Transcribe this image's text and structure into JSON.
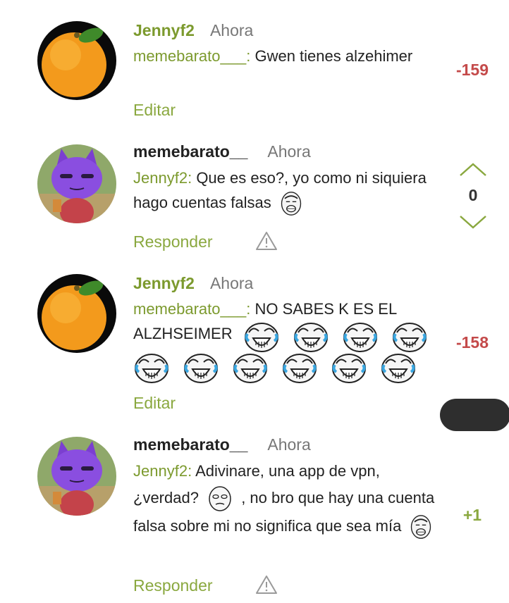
{
  "comments": [
    {
      "author": "Jennyf2",
      "time": "Ahora",
      "mention": "memebarato___",
      "text": "Gwen tienes alzehimer",
      "action": "Editar",
      "score": "-159",
      "avatar": "orange-avatar"
    },
    {
      "author": "memebarato__",
      "time": "Ahora",
      "mention": "Jennyf2",
      "text": "Que es eso?, yo como ni siquiera hago cuentas falsas",
      "action": "Responder",
      "score": "0",
      "avatar": "purple-cat-avatar"
    },
    {
      "author": "Jennyf2",
      "time": "Ahora",
      "mention": "memebarato___",
      "text": "NO SABES K ES EL ALZHSEIMER",
      "action": "Editar",
      "score": "-158",
      "avatar": "orange-avatar"
    },
    {
      "author": "memebarato__",
      "time": "Ahora",
      "mention": "Jennyf2",
      "text_part1": "Adivinare, una app de vpn, ¿verdad?",
      "text_part2": ", no bro que hay una cuenta falsa sobre mi no significa que sea mía",
      "action": "Responder",
      "score": "+1",
      "avatar": "purple-cat-avatar"
    }
  ],
  "colors": {
    "accent_green": "#8aa83f",
    "negative_red": "#c44a4a",
    "text": "#222222",
    "muted": "#777777"
  },
  "icons": {
    "upvote": "chevron-up-icon",
    "downvote": "chevron-down-icon",
    "report": "warning-triangle-icon",
    "meme_face": "yao-ming-meme-icon",
    "laughing_face": "laughing-crying-meme-icon",
    "skeptical_face": "skeptical-meme-icon"
  }
}
